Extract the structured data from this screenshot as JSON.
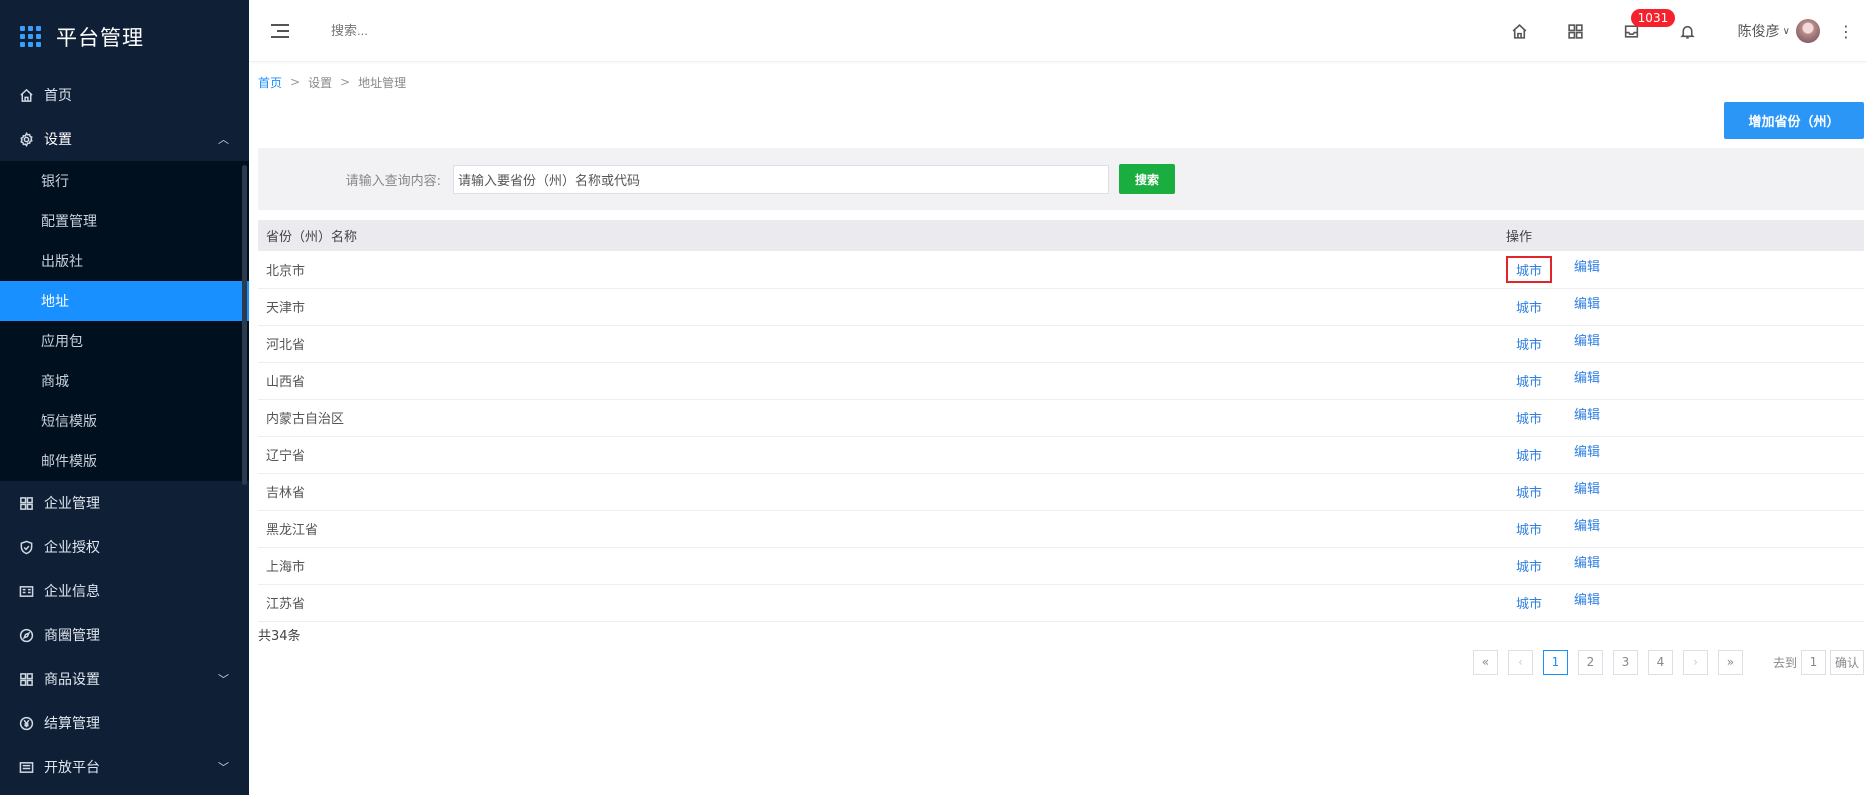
{
  "app": {
    "title": "平台管理"
  },
  "sidebar": {
    "items": [
      {
        "label": "首页",
        "icon": "home-icon"
      },
      {
        "label": "设置",
        "icon": "gear-icon",
        "expanded": true,
        "children": [
          {
            "label": "银行"
          },
          {
            "label": "配置管理"
          },
          {
            "label": "出版社"
          },
          {
            "label": "地址",
            "active": true
          },
          {
            "label": "应用包"
          },
          {
            "label": "商城"
          },
          {
            "label": "短信模版"
          },
          {
            "label": "邮件模版"
          }
        ]
      },
      {
        "label": "企业管理",
        "icon": "building-icon"
      },
      {
        "label": "企业授权",
        "icon": "shield-icon"
      },
      {
        "label": "企业信息",
        "icon": "id-card-icon"
      },
      {
        "label": "商圈管理",
        "icon": "compass-icon"
      },
      {
        "label": "商品设置",
        "icon": "grid-icon",
        "has_children": true
      },
      {
        "label": "结算管理",
        "icon": "yen-icon"
      },
      {
        "label": "开放平台",
        "icon": "list-icon",
        "has_children": true
      }
    ]
  },
  "topbar": {
    "search_placeholder": "搜索...",
    "badge_count": "1031",
    "user_name": "陈俊彦"
  },
  "breadcrumb": {
    "home": "首页",
    "level2": "设置",
    "current": "地址管理"
  },
  "toolbar": {
    "add_label": "增加省份（州）"
  },
  "filter": {
    "label": "请输入查询内容:",
    "input_value": "请输入要省份（州）名称或代码",
    "search_label": "搜索"
  },
  "table": {
    "columns": [
      "省份（州）名称",
      "操作"
    ],
    "city_link": "城市",
    "edit_link": "编辑",
    "rows": [
      "北京市",
      "天津市",
      "河北省",
      "山西省",
      "内蒙古自治区",
      "辽宁省",
      "吉林省",
      "黑龙江省",
      "上海市",
      "江苏省"
    ]
  },
  "footer": {
    "total": "共34条"
  },
  "pagination": {
    "first": "«",
    "prev": "‹",
    "next": "›",
    "last": "»",
    "pages": [
      "1",
      "2",
      "3",
      "4"
    ],
    "current": "1",
    "goto_label": "去到",
    "goto_value": "1",
    "confirm_label": "确认"
  },
  "colors": {
    "sidebar_bg": "#0f1f36",
    "accent": "#1890ff",
    "search_button": "#1aad3f",
    "link": "#2f7fe0",
    "badge": "#f5222d",
    "highlight_border": "#e0262b"
  }
}
